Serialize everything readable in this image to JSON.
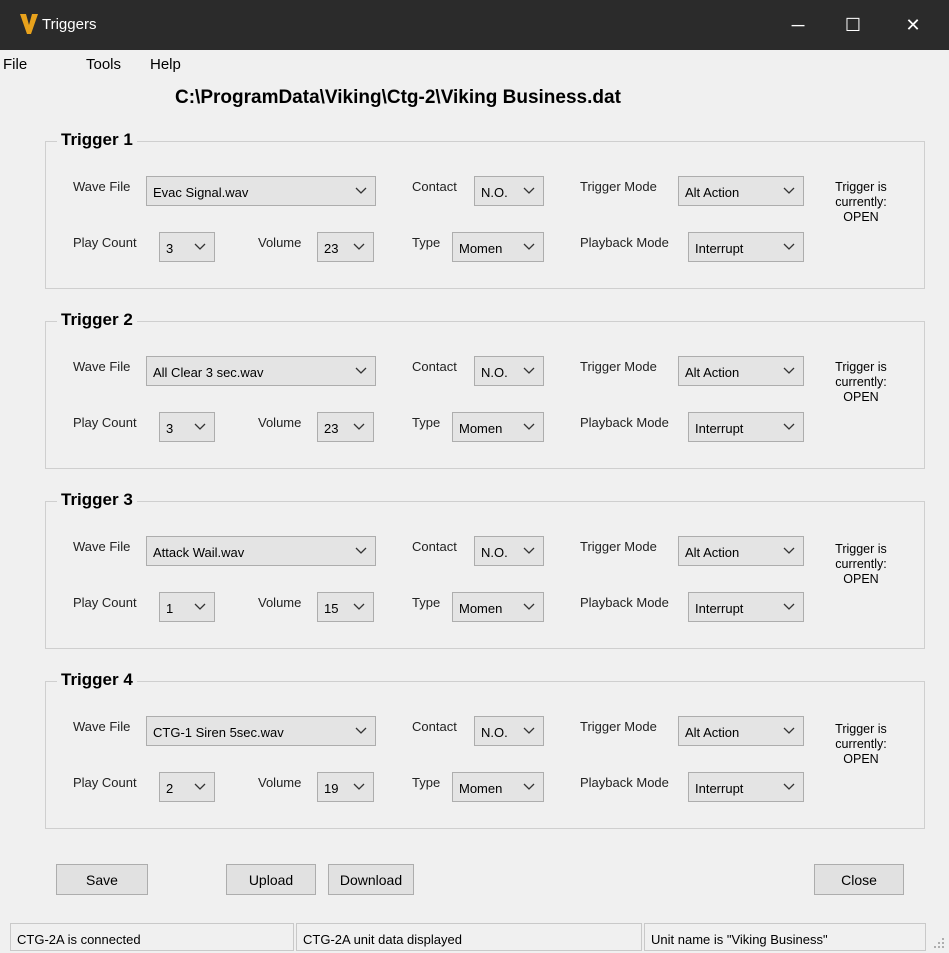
{
  "window": {
    "title": "Triggers",
    "minimize": "─",
    "maximize": "☐",
    "close": "✕",
    "logo_icon": "viking-v-logo"
  },
  "menu": {
    "file": "File",
    "tools": "Tools",
    "help": "Help"
  },
  "file_path": "C:\\ProgramData\\Viking\\Ctg-2\\Viking Business.dat",
  "labels": {
    "wave_file": "Wave File",
    "contact": "Contact",
    "trigger_mode": "Trigger Mode",
    "play_count": "Play Count",
    "volume": "Volume",
    "type": "Type",
    "playback_mode": "Playback Mode",
    "trigger_is": "Trigger is",
    "currently": "currently:"
  },
  "triggers": [
    {
      "title": "Trigger 1",
      "wave_file": "Evac Signal.wav",
      "contact": "N.O.",
      "trigger_mode": "Alt Action",
      "play_count": "3",
      "volume": "23",
      "type": "Momen",
      "playback_mode": "Interrupt",
      "state": "OPEN"
    },
    {
      "title": "Trigger 2",
      "wave_file": "All Clear 3 sec.wav",
      "contact": "N.O.",
      "trigger_mode": "Alt Action",
      "play_count": "3",
      "volume": "23",
      "type": "Momen",
      "playback_mode": "Interrupt",
      "state": "OPEN"
    },
    {
      "title": "Trigger 3",
      "wave_file": "Attack Wail.wav",
      "contact": "N.O.",
      "trigger_mode": "Alt Action",
      "play_count": "1",
      "volume": "15",
      "type": "Momen",
      "playback_mode": "Interrupt",
      "state": "OPEN"
    },
    {
      "title": "Trigger 4",
      "wave_file": "CTG-1 Siren 5sec.wav",
      "contact": "N.O.",
      "trigger_mode": "Alt Action",
      "play_count": "2",
      "volume": "19",
      "type": "Momen",
      "playback_mode": "Interrupt",
      "state": "OPEN"
    }
  ],
  "buttons": {
    "save": "Save",
    "upload": "Upload",
    "download": "Download",
    "close": "Close"
  },
  "status": {
    "connection": "CTG-2A is connected",
    "data": "CTG-2A unit data displayed",
    "unit_name": "Unit name is \"Viking Business\""
  }
}
